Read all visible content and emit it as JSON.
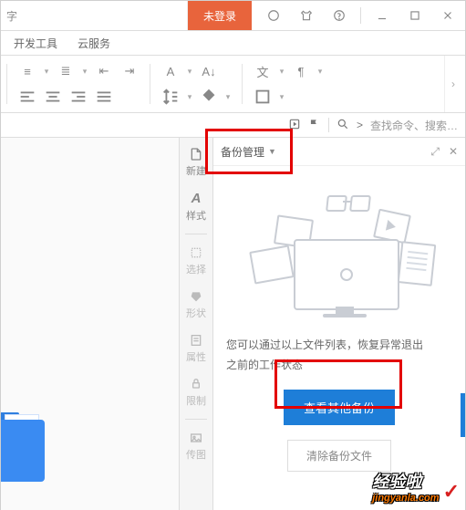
{
  "titlebar": {
    "left_fragment": "字",
    "login_label": "未登录"
  },
  "menu": {
    "dev_tools": "开发工具",
    "cloud": "云服务"
  },
  "ribbon": {
    "expand_glyph": "›"
  },
  "cmdbar": {
    "search_prefix": ">",
    "search_placeholder": "查找命令、搜索…"
  },
  "rail": {
    "new": "新建",
    "style": "样式",
    "select": "选择",
    "shape": "形状",
    "attr": "属性",
    "limit": "限制",
    "legend": "传图"
  },
  "panel": {
    "title": "备份管理",
    "body_line1": "您可以通过以上文件列表，恢复异常退出",
    "body_line2": "之前的工作状态",
    "primary_btn": "查看其他备份",
    "secondary_btn": "清除备份文件",
    "expand_glyph": "⤢",
    "close_glyph": "✕"
  },
  "watermark": {
    "brand": "经验啦",
    "domain": "jingyanla.com",
    "check": "✓"
  }
}
